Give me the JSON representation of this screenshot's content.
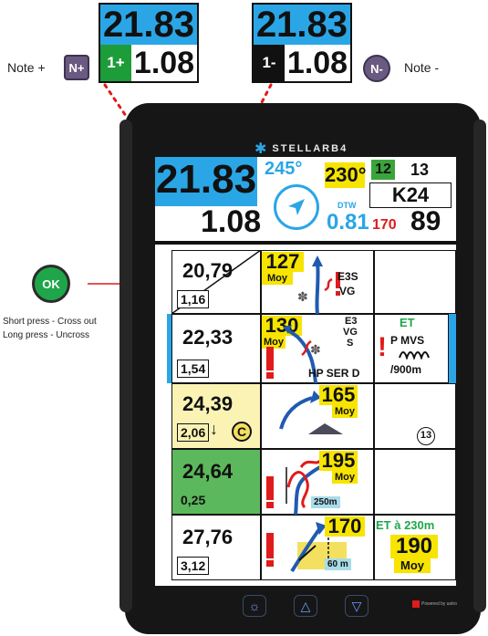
{
  "callouts": {
    "left": {
      "top": "21.83",
      "badge": "1+",
      "value": "1.08",
      "badge_color": "#1d9c3a"
    },
    "right": {
      "top": "21.83",
      "badge": "1-",
      "value": "1.08",
      "badge_color": "#111111"
    }
  },
  "labels": {
    "note_plus": "Note +",
    "note_minus": "Note -",
    "key_plus": "N+",
    "key_minus": "N-",
    "ok": "OK",
    "short_press": "Short press - Cross out",
    "long_press": "Long press - Uncross"
  },
  "brand": "STELLARB4",
  "header": {
    "big_value": "21.83",
    "sub_value": "1.08",
    "heading_deg": "245°",
    "cap": "230°",
    "green_box": "12",
    "count": "13",
    "km_label": "K24",
    "dtw_label": "DTW",
    "dtw_value": "0.81",
    "red_val": "170",
    "big_right": "89"
  },
  "rows": [
    {
      "main": "20,79",
      "sub": "1,16",
      "speed": "127",
      "speed_label": "Moy",
      "notes": [
        "E3S",
        "VG"
      ],
      "right": ""
    },
    {
      "main": "22,33",
      "sub": "1,54",
      "speed": "130",
      "speed_label": "Moy",
      "notes": [
        "E3",
        "VG",
        "S",
        "HP SER D"
      ],
      "right_green": "ET",
      "right_text": "P MVS",
      "right_sub": "/900m"
    },
    {
      "main": "24,39",
      "sub": "2,06",
      "badge": "C",
      "speed": "165",
      "speed_label": "Moy",
      "circle": "13"
    },
    {
      "main": "24,64",
      "sub": "0,25",
      "speed": "195",
      "speed_label": "Moy",
      "dist": "250m"
    },
    {
      "main": "27,76",
      "sub": "3,12",
      "speed": "170",
      "dist": "60 m",
      "right_green": "ET à 230m",
      "right_speed": "190",
      "right_label": "Moy"
    }
  ],
  "footer": {
    "brand_small": "Powered by astro"
  }
}
